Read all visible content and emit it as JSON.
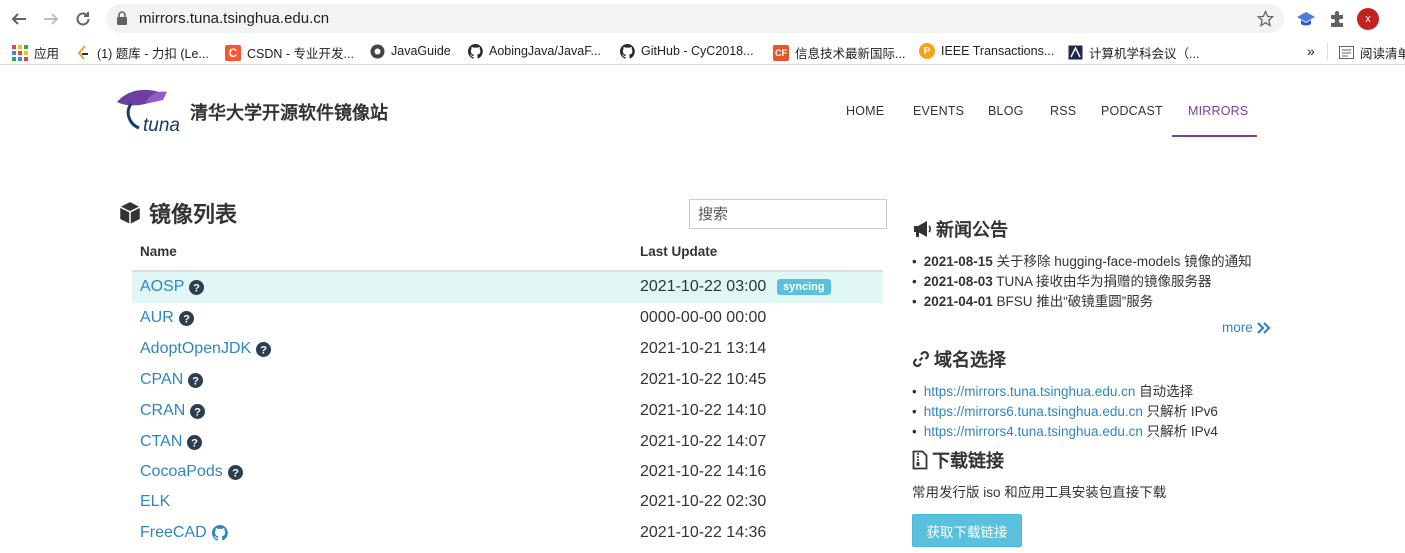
{
  "browser": {
    "url": "mirrors.tuna.tsinghua.edu.cn",
    "profile_initial": "x",
    "bookmarks": [
      {
        "label": "应用",
        "icon": "apps-grid-icon"
      },
      {
        "label": "(1) 题库 - 力扣 (Le...",
        "icon": "leetcode-icon"
      },
      {
        "label": "CSDN - 专业开发...",
        "icon": "csdn-icon"
      },
      {
        "label": "JavaGuide",
        "icon": "javaguide-icon"
      },
      {
        "label": "AobingJava/JavaF...",
        "icon": "github-icon"
      },
      {
        "label": "GitHub - CyC2018...",
        "icon": "github-icon"
      },
      {
        "label": "信息技术最新国际...",
        "icon": "ccf-icon"
      },
      {
        "label": "IEEE Transactions...",
        "icon": "ieee-icon"
      },
      {
        "label": "计算机学科会议（...",
        "icon": "conference-icon"
      }
    ],
    "overflow_label": "»",
    "reading_list_label": "阅读清单"
  },
  "site": {
    "logo_text": "tuna",
    "title": "清华大学开源软件镜像站",
    "nav": [
      "HOME",
      "EVENTS",
      "BLOG",
      "RSS",
      "PODCAST",
      "MIRRORS"
    ],
    "active_nav": "MIRRORS"
  },
  "mirrors": {
    "title": "镜像列表",
    "search_placeholder": "搜索",
    "col_name": "Name",
    "col_update": "Last Update",
    "rows": [
      {
        "name": "AOSP",
        "date": "2021-10-22 03:00",
        "badge": "syncing",
        "icon": "help-circle-icon"
      },
      {
        "name": "AUR",
        "date": "0000-00-00 00:00",
        "icon": "help-circle-icon"
      },
      {
        "name": "AdoptOpenJDK",
        "date": "2021-10-21 13:14",
        "icon": "help-circle-icon"
      },
      {
        "name": "CPAN",
        "date": "2021-10-22 10:45",
        "icon": "help-circle-icon"
      },
      {
        "name": "CRAN",
        "date": "2021-10-22 14:10",
        "icon": "help-circle-icon"
      },
      {
        "name": "CTAN",
        "date": "2021-10-22 14:07",
        "icon": "help-circle-icon"
      },
      {
        "name": "CocoaPods",
        "date": "2021-10-22 14:16",
        "icon": "help-circle-icon"
      },
      {
        "name": "ELK",
        "date": "2021-10-22 02:30"
      },
      {
        "name": "FreeCAD",
        "date": "2021-10-22 14:36",
        "icon": "github-icon"
      }
    ]
  },
  "news": {
    "title": "新闻公告",
    "items": [
      {
        "date": "2021-08-15",
        "text": " 关于移除 hugging-face-models 镜像的通知"
      },
      {
        "date": "2021-08-03",
        "text": " TUNA 接收由华为捐赠的镜像服务器"
      },
      {
        "date": "2021-04-01",
        "text": " BFSU 推出“破镜重圆”服务"
      }
    ],
    "more": "more"
  },
  "domains": {
    "title": "域名选择",
    "items": [
      {
        "url": "https://mirrors.tuna.tsinghua.edu.cn",
        "note": " 自动选择"
      },
      {
        "url": "https://mirrors6.tuna.tsinghua.edu.cn",
        "note": " 只解析 IPv6"
      },
      {
        "url": "https://mirrors4.tuna.tsinghua.edu.cn",
        "note": " 只解析 IPv4"
      }
    ]
  },
  "downloads": {
    "title": "下载链接",
    "text": "常用发行版 iso 和应用工具安装包直接下载",
    "button": "获取下载链接"
  },
  "colors": {
    "accent_purple": "#7b3f97",
    "link_blue": "#2e86c1",
    "info_blue": "#5bc0de",
    "highlight_row": "#e0f7f6"
  }
}
